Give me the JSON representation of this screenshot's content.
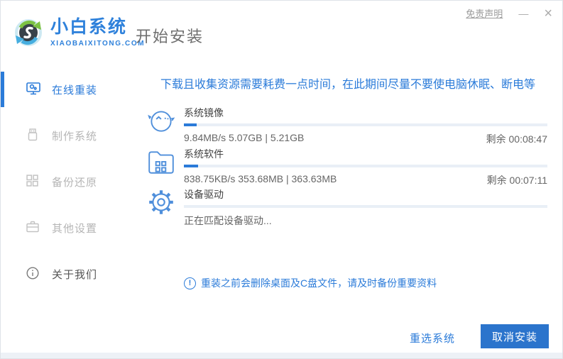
{
  "window": {
    "brand": {
      "name": "小白系统",
      "domain": "XIAOBAIXITONG.COM"
    },
    "title": "开始安装",
    "controls": {
      "disclaimer": "免责声明",
      "minimize": "—",
      "close": "×"
    }
  },
  "sidebar": {
    "items": [
      {
        "label": "在线重装",
        "icon": "monitor-reinstall-icon",
        "active": true
      },
      {
        "label": "制作系统",
        "icon": "usb-drive-icon",
        "active": false
      },
      {
        "label": "备份还原",
        "icon": "backup-blocks-icon",
        "active": false
      },
      {
        "label": "其他设置",
        "icon": "briefcase-settings-icon",
        "active": false
      },
      {
        "label": "关于我们",
        "icon": "info-circle-icon",
        "active": false
      }
    ]
  },
  "main": {
    "warning": "下载且收集资源需要耗费一点时间，在此期间尽量不要使电脑休眠、断电等",
    "tasks": [
      {
        "icon": "mascot-face-icon",
        "title": "系统镜像",
        "progress_percent": 3.5,
        "stats": "9.84MB/s 5.07GB | 5.21GB",
        "remaining": "剩余 00:08:47"
      },
      {
        "icon": "folder-apps-icon",
        "title": "系统软件",
        "progress_percent": 4,
        "stats": "838.75KB/s 353.68MB | 363.63MB",
        "remaining": "剩余 00:07:11"
      },
      {
        "icon": "gear-icon",
        "title": "设备驱动",
        "progress_percent": 0,
        "stats": "正在匹配设备驱动...",
        "remaining": ""
      }
    ],
    "notice": {
      "icon_glyph": "!",
      "text": "重装之前会删除桌面及C盘文件，请及时备份重要资料"
    },
    "actions": {
      "reselect": "重选系统",
      "cancel": "取消安装"
    }
  },
  "colors": {
    "accent": "#2b7bd9",
    "button_bg": "#2b74cc",
    "progress_track": "#e9eff6",
    "inactive_gray": "#b5b5b5",
    "bottom_strip": "#edf1f6"
  }
}
